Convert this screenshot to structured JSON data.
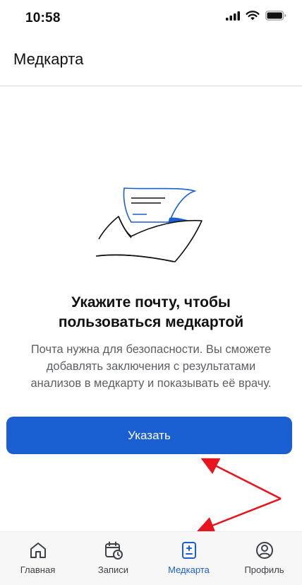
{
  "status_bar": {
    "time": "10:58",
    "icons": [
      "cellular-signal-icon",
      "wifi-icon",
      "battery-icon"
    ]
  },
  "header": {
    "title": "Медкарта"
  },
  "empty_state": {
    "illustration": "envelope-with-letter-icon",
    "title": "Укажите почту, чтобы пользоваться медкартой",
    "text": "Почта нужна для безопасности. Вы сможете добавлять заключения с результатами анализов в медкарту и показывать её врачу.",
    "button_label": "Указать"
  },
  "tabbar": {
    "items": [
      {
        "label": "Главная",
        "icon": "home-icon",
        "active": false
      },
      {
        "label": "Записи",
        "icon": "calendar-clock-icon",
        "active": false
      },
      {
        "label": "Медкарта",
        "icon": "medical-record-icon",
        "active": true
      },
      {
        "label": "Профиль",
        "icon": "profile-icon",
        "active": false
      }
    ]
  },
  "colors": {
    "accent": "#1a5fd1",
    "annotation_arrow": "#e8141e",
    "text_secondary": "#5b5f66"
  }
}
